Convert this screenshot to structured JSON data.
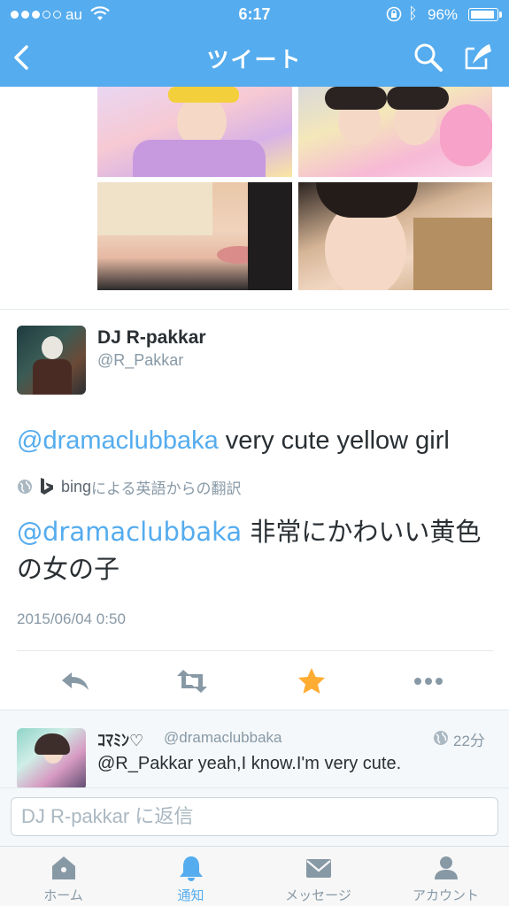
{
  "status_bar": {
    "carrier": "au",
    "time": "6:17",
    "battery_percent": "96%",
    "battery_level": 0.96,
    "signal_bars_filled": 3,
    "signal_bars_total": 5
  },
  "nav": {
    "title": "ツイート",
    "icons": [
      "chevron-left-icon",
      "search-icon",
      "compose-icon"
    ]
  },
  "photos": {
    "count": 4
  },
  "tweet": {
    "author_name": "DJ R-pakkar",
    "author_handle": "@R_Pakkar",
    "mention": "@dramaclubbaka",
    "text_en_rest": " very cute yellow girl",
    "translation_provider": "bing",
    "translation_note": "による英語からの翻訳",
    "text_jp_rest": " 非常にかわいい黄色の女の子",
    "timestamp": "2015/06/04 0:50",
    "actions": [
      "reply-icon",
      "retweet-icon",
      "favorite-icon",
      "more-icon"
    ],
    "favorited": true
  },
  "reply_preview": {
    "name": "ｺﾏﾐﾝ♡",
    "handle": "@dramaclubbaka",
    "time": "22分",
    "text": "@R_Pakkar yeah,I know.I'm very cute."
  },
  "reply_input": {
    "placeholder": "DJ R-pakkar に返信",
    "value": ""
  },
  "tabbar": {
    "tabs": [
      {
        "label": "ホーム",
        "icon": "home-icon",
        "active": false
      },
      {
        "label": "通知",
        "icon": "bell-icon",
        "active": true
      },
      {
        "label": "メッセージ",
        "icon": "envelope-icon",
        "active": false
      },
      {
        "label": "アカウント",
        "icon": "person-icon",
        "active": false
      }
    ]
  },
  "colors": {
    "brand": "#55acee",
    "favorite": "#ffac33",
    "muted": "#8899a6",
    "text": "#292f33"
  }
}
